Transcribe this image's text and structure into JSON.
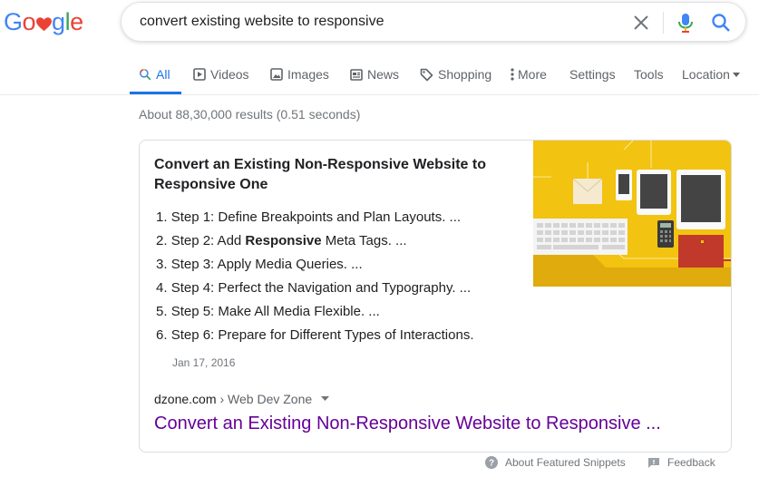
{
  "logo": {
    "letters": [
      "G",
      "o",
      "g",
      "l",
      "e"
    ],
    "colors": {
      "blue": "#4285f4",
      "red": "#ea4335",
      "yellow": "#fbbc05",
      "green": "#34a853"
    }
  },
  "search": {
    "query": "convert existing website to responsive"
  },
  "tabs": [
    {
      "label": "All",
      "icon": "search-icon",
      "active": true
    },
    {
      "label": "Videos",
      "icon": "play-icon"
    },
    {
      "label": "Images",
      "icon": "image-icon"
    },
    {
      "label": "News",
      "icon": "news-icon"
    },
    {
      "label": "Shopping",
      "icon": "tag-icon"
    },
    {
      "label": "More",
      "icon": "more-vertical-icon"
    },
    {
      "label": "Settings"
    },
    {
      "label": "Tools"
    },
    {
      "label": "Location"
    }
  ],
  "result_stats": "About 88,30,000 results (0.51 seconds)",
  "featured_snippet": {
    "title_line1": "Convert an Existing Non-Responsive Website to",
    "title_line2": "Responsive One",
    "steps": [
      {
        "num": "1.",
        "text": "Step 1: Define Breakpoints and Plan Layouts. ..."
      },
      {
        "num": "2.",
        "pre": "Step 2: Add ",
        "bold": "Responsive",
        "post": " Meta Tags. ..."
      },
      {
        "num": "3.",
        "text": "Step 3: Apply Media Queries. ..."
      },
      {
        "num": "4.",
        "text": "Step 4: Perfect the Navigation and Typography. ..."
      },
      {
        "num": "5.",
        "text": "Step 5: Make All Media Flexible. ..."
      },
      {
        "num": "6.",
        "text": "Step 6: Prepare for Different Types of Interactions."
      }
    ],
    "date": "Jan 17, 2016",
    "site": "dzone.com",
    "breadcrumb": "› Web Dev Zone",
    "link_text": "Convert an Existing Non-Responsive Website to Responsive ...",
    "image_colors": {
      "background": "#f2c310",
      "shadow": "#d9a30b",
      "accent": "#c0392b"
    }
  },
  "footer": {
    "about": "About Featured Snippets",
    "feedback": "Feedback"
  }
}
